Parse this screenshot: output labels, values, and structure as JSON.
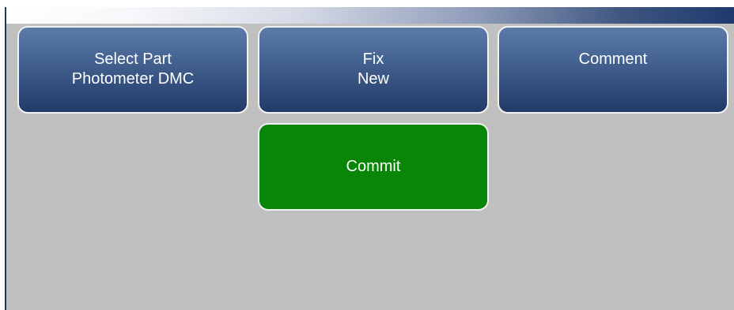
{
  "screen": {
    "buttons": {
      "select_part": {
        "line1": "Select Part",
        "line2": "Photometer DMC"
      },
      "fix": {
        "line1": "Fix",
        "line2": "New"
      },
      "comment": {
        "label": "Comment"
      },
      "commit": {
        "label": "Commit"
      }
    }
  },
  "colors": {
    "button_blue": "#2f4a78",
    "button_green": "#078607",
    "background": "#c0c0c0"
  }
}
